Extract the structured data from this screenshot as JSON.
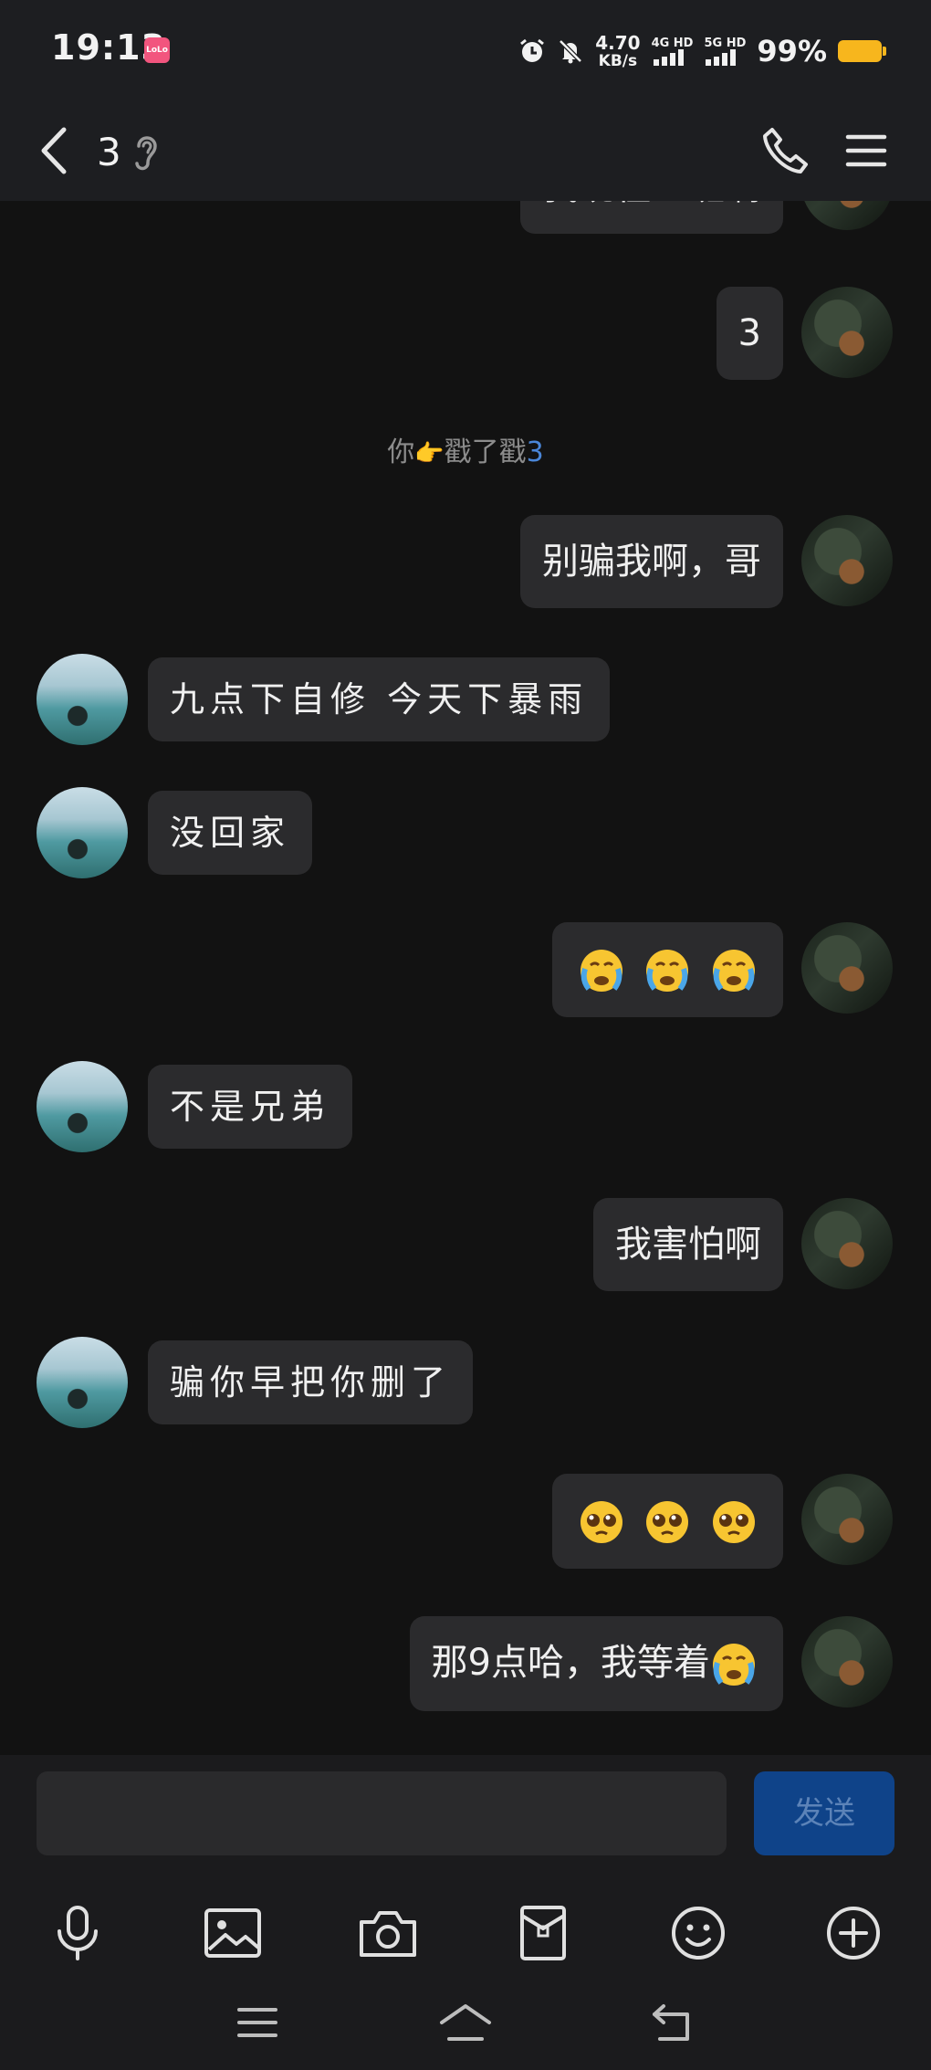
{
  "status_bar": {
    "time": "19:13",
    "app_badge": "LoLo",
    "net_speed_value": "4.70",
    "net_speed_unit": "KB/s",
    "sim1_label": "4G HD",
    "sim2_label": "5G HD",
    "battery_percent": "99%"
  },
  "header": {
    "title": "3"
  },
  "messages": {
    "m0": "我现在上班啊",
    "m1": "3",
    "system_prefix": "你",
    "system_action": "戳了戳",
    "system_target": "3",
    "m2": "别骗我啊，哥",
    "m3": "九点下自修 今天下暴雨",
    "m4": "没回家",
    "m6": "不是兄弟",
    "m7": "我害怕啊",
    "m8": "骗你早把你删了",
    "m10_text": "那9点哈，我等着"
  },
  "composer": {
    "input_value": "",
    "send_label": "发送"
  },
  "colors": {
    "bubble": "#2b2b2d",
    "accent_blue": "#4a86d8",
    "send_bg": "#0f4389",
    "battery": "#f7b61d"
  },
  "icons": {
    "toolbar": [
      "microphone-icon",
      "image-icon",
      "camera-icon",
      "red-packet-icon",
      "emoji-icon",
      "plus-icon"
    ],
    "system_nav": [
      "menu-icon",
      "home-icon",
      "back-icon"
    ]
  }
}
